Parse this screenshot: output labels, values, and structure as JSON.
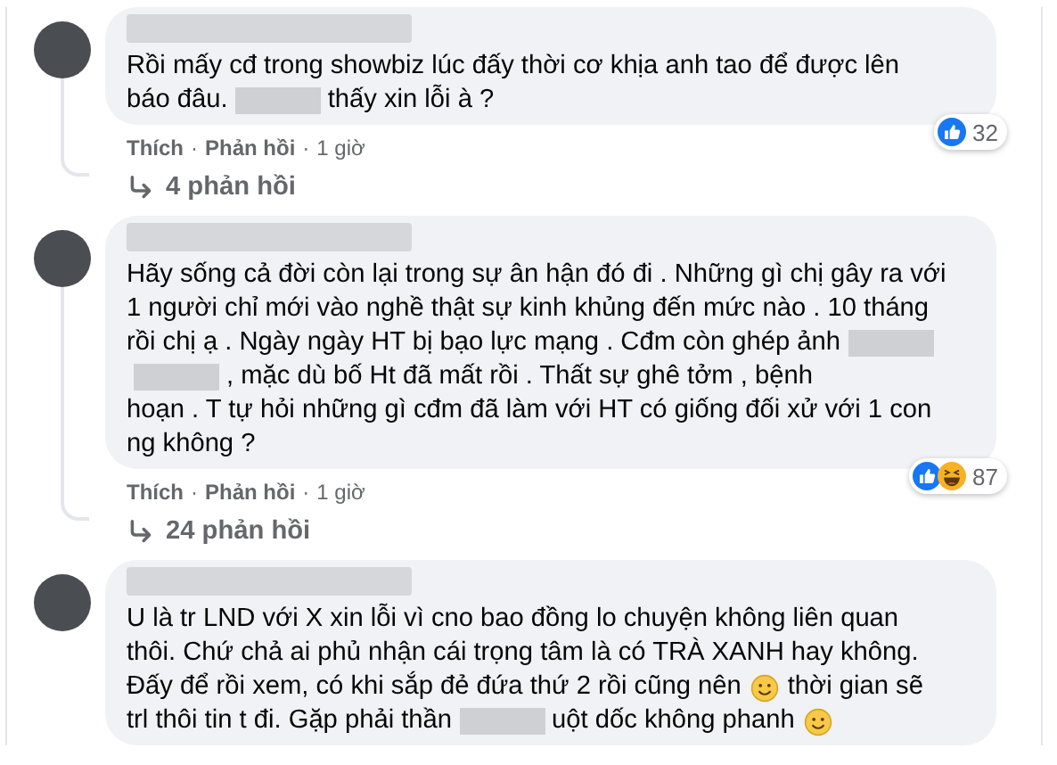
{
  "comments": [
    {
      "lines": [
        [
          {
            "kind": "text",
            "text": "Rồi mấy cđ trong showbiz lúc đấy thời cơ khịa anh tao để được lên"
          }
        ],
        [
          {
            "kind": "text",
            "text": "báo đâu."
          },
          {
            "kind": "blur"
          },
          {
            "kind": "text",
            "text": "thấy xin lỗi à ?"
          }
        ]
      ],
      "reactions": {
        "icons": [
          {
            "kind": "like"
          }
        ],
        "count": "32"
      },
      "actions": [
        "Thích",
        "Phản hồi"
      ],
      "separator": "·",
      "time": "1 giờ",
      "replies": "4 phản hồi"
    },
    {
      "lines": [
        [
          {
            "kind": "text",
            "text": "Hãy sống cả đời còn lại trong sự ân hận đó đi . Những gì chị gây ra với"
          }
        ],
        [
          {
            "kind": "text",
            "text": "1 người chỉ mới vào nghề thật sự kinh khủng đến mức nào . 10 tháng"
          }
        ],
        [
          {
            "kind": "text",
            "text": "rồi chị ạ . Ngày ngày HT bị bạo lực mạng . Cđm còn ghép ảnh"
          },
          {
            "kind": "blur"
          }
        ],
        [
          {
            "kind": "blur"
          },
          {
            "kind": "text",
            "text": ", mặc dù bố Ht đã mất rồi . Thất sự ghê tởm , bệnh"
          }
        ],
        [
          {
            "kind": "text",
            "text": "hoạn . T tự hỏi những gì cđm đã làm với HT có giống đối xử với 1 con"
          }
        ],
        [
          {
            "kind": "text",
            "text": "ng không ?"
          }
        ]
      ],
      "reactions": {
        "icons": [
          {
            "kind": "like"
          },
          {
            "kind": "haha"
          }
        ],
        "count": "87"
      },
      "actions": [
        "Thích",
        "Phản hồi"
      ],
      "separator": "·",
      "time": "1 giờ",
      "replies": "24 phản hồi"
    },
    {
      "lines": [
        [
          {
            "kind": "text",
            "text": "U là tr LND với X xin lỗi vì cno bao đồng lo chuyện không liên quan"
          }
        ],
        [
          {
            "kind": "text",
            "text": "thôi. Chứ chả ai phủ nhận cái trọng tâm là có TRÀ XANH hay không."
          }
        ],
        [
          {
            "kind": "text",
            "text": "Đấy để rồi xem, có khi sắp đẻ đứa thứ 2 rồi cũng nên"
          },
          {
            "kind": "emoji"
          },
          {
            "kind": "text",
            "text": "thời gian sẽ"
          }
        ],
        [
          {
            "kind": "text",
            "text": "trl thôi tin t đi. Gặp phải thần"
          },
          {
            "kind": "blur"
          },
          {
            "kind": "text",
            "text": "uột dốc không phanh"
          },
          {
            "kind": "emoji"
          }
        ]
      ]
    }
  ]
}
